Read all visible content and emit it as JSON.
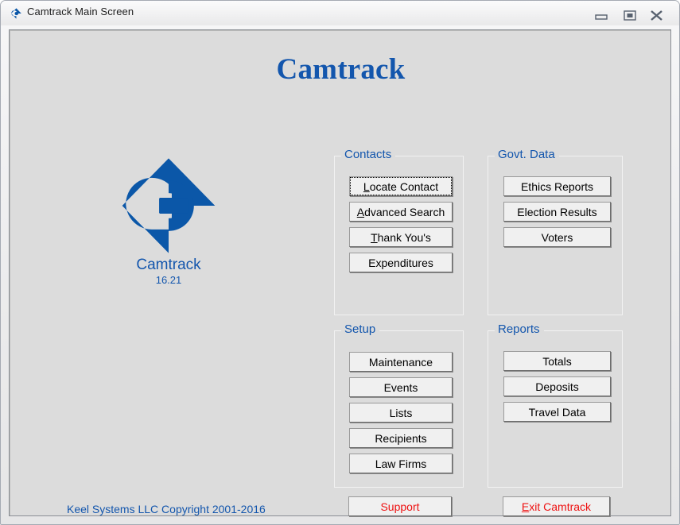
{
  "window": {
    "title": "Camtrack Main Screen",
    "icon": "camtrack-logo-icon",
    "controls": {
      "minimize": "minimize-icon",
      "maximize": "maximize-icon",
      "close": "close-icon"
    }
  },
  "header": {
    "title": "Camtrack"
  },
  "logo": {
    "name": "Camtrack",
    "version": "16.21",
    "color": "#1356ad"
  },
  "groups": {
    "contacts": {
      "label": "Contacts",
      "buttons": [
        {
          "label": "Locate Contact",
          "accel": "L",
          "focused": true
        },
        {
          "label": "Advanced Search",
          "accel": "A",
          "focused": false
        },
        {
          "label": "Thank You's",
          "accel": "T",
          "focused": false
        },
        {
          "label": "Expenditures",
          "accel": "",
          "focused": false
        }
      ]
    },
    "govt_data": {
      "label": "Govt. Data",
      "buttons": [
        {
          "label": "Ethics Reports",
          "accel": "",
          "focused": false
        },
        {
          "label": "Election Results",
          "accel": "",
          "focused": false
        },
        {
          "label": "Voters",
          "accel": "",
          "focused": false
        }
      ]
    },
    "setup": {
      "label": "Setup",
      "buttons": [
        {
          "label": "Maintenance",
          "accel": "",
          "focused": false
        },
        {
          "label": "Events",
          "accel": "",
          "focused": false
        },
        {
          "label": "Lists",
          "accel": "",
          "focused": false
        },
        {
          "label": "Recipients",
          "accel": "",
          "focused": false
        },
        {
          "label": "Law Firms",
          "accel": "",
          "focused": false
        }
      ]
    },
    "reports": {
      "label": "Reports",
      "buttons": [
        {
          "label": "Totals",
          "accel": "",
          "focused": false
        },
        {
          "label": "Deposits",
          "accel": "",
          "focused": false
        },
        {
          "label": "Travel Data",
          "accel": "",
          "focused": false
        }
      ]
    }
  },
  "footer": {
    "copyright": "Keel Systems LLC Copyright 2001-2016",
    "support_label": "Support",
    "support_accel": "",
    "exit_label": "Exit Camtrack",
    "exit_accel": "E",
    "accent_red": "#ee1111",
    "accent_blue": "#1356ad"
  }
}
